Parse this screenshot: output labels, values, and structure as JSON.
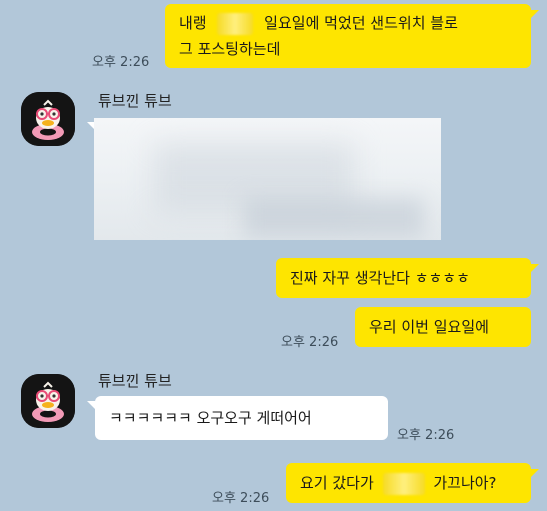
{
  "colors": {
    "background": "#b2c7d9",
    "my_bubble": "#fee500",
    "other_bubble": "#ffffff"
  },
  "sender": {
    "name": "튜브낀 튜브",
    "avatar_icon": "tube-duck-avatar-icon"
  },
  "messages": [
    {
      "from": "me",
      "lines": [
        "내랭",
        "일요일에 먹었던 샌드위치 블로",
        "그 포스팅하는데"
      ],
      "time": "오후 2:26"
    },
    {
      "from": "other",
      "type": "image",
      "time": ""
    },
    {
      "from": "me",
      "text": "진짜 자꾸 생각난다 ㅎㅎㅎㅎ",
      "time": ""
    },
    {
      "from": "me",
      "text": "우리 이번 일요일에",
      "time": "오후 2:26"
    },
    {
      "from": "other",
      "text": "ㅋㅋㅋㅋㅋㅋ 오구오구 게떠어어",
      "time": "오후 2:26"
    },
    {
      "from": "me",
      "text_before": "요기 갔다가",
      "text_after": "가끄나아?",
      "time": "오후 2:26"
    }
  ]
}
